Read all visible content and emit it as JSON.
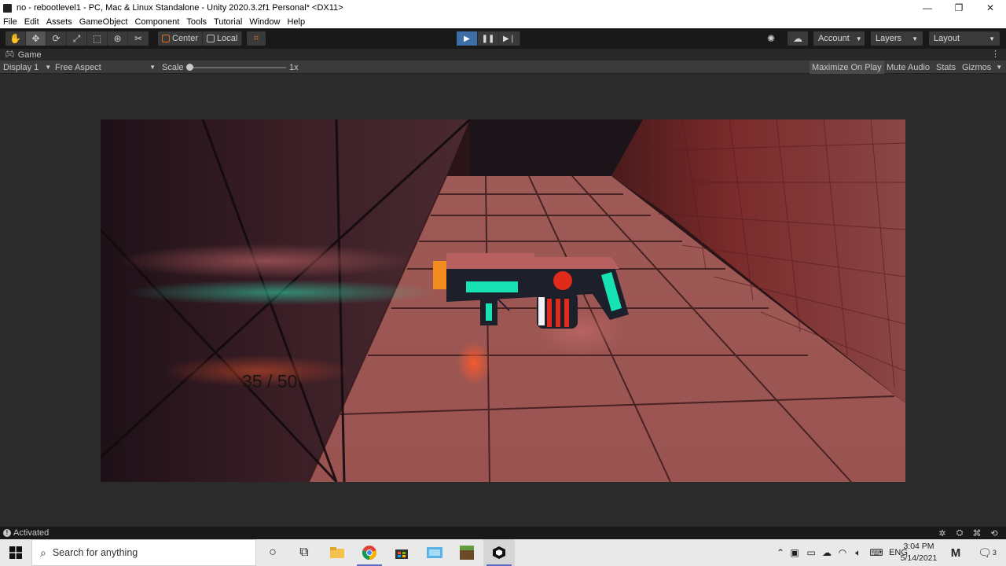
{
  "window": {
    "title": "no - rebootlevel1 - PC, Mac & Linux Standalone - Unity 2020.3.2f1 Personal* <DX11>",
    "minimize": "—",
    "maximize": "❐",
    "close": "✕"
  },
  "menu": {
    "items": [
      "File",
      "Edit",
      "Assets",
      "GameObject",
      "Component",
      "Tools",
      "Tutorial",
      "Window",
      "Help"
    ]
  },
  "toolbar": {
    "tools": [
      "hand-tool-icon",
      "move-tool-icon",
      "rotate-tool-icon",
      "scale-tool-icon",
      "rect-tool-icon",
      "transform-tool-icon",
      "custom-tool-icon"
    ],
    "pivot_label": "Center",
    "space_label": "Local",
    "account_label": "Account",
    "layers_label": "Layers",
    "layout_label": "Layout"
  },
  "game_tab": {
    "label": "Game"
  },
  "game_toolbar": {
    "display_label": "Display 1",
    "aspect_label": "Free Aspect",
    "scale_label": "Scale",
    "scale_value": "1x",
    "maximize_label": "Maximize On Play",
    "mute_label": "Mute Audio",
    "stats_label": "Stats",
    "gizmos_label": "Gizmos"
  },
  "game_view": {
    "ammo_text": "35 / 50",
    "colors": {
      "floor": "#8a4a48",
      "wall_left": "#3a1e24",
      "wall_right": "#6a2a2a",
      "gun_body": "#1d1f2b",
      "gun_top": "#b85f5f",
      "gun_accent": "#16e2b4",
      "gun_red": "#e02a1a",
      "gun_orange": "#f28c1e"
    }
  },
  "status": {
    "text": "Activated"
  },
  "taskbar": {
    "search_placeholder": "Search for anything",
    "time": "3:04 PM",
    "date": "5/14/2021",
    "language": "ENG",
    "notification_count": "3"
  }
}
